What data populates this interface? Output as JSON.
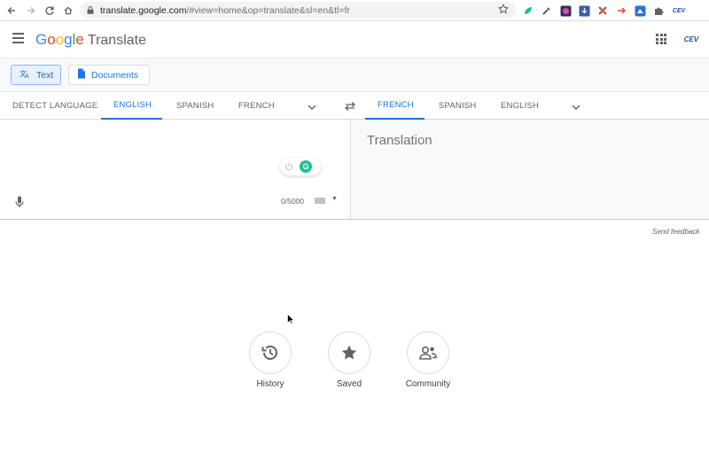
{
  "browser": {
    "url_host": "translate.google.com",
    "url_path": "/#view=home&op=translate&sl=en&tl=fr",
    "account_badge": "CEV"
  },
  "header": {
    "logo_letters": [
      "G",
      "o",
      "o",
      "g",
      "l",
      "e"
    ],
    "logo_colors": [
      "#4285f4",
      "#ea4335",
      "#fbbc05",
      "#4285f4",
      "#34a853",
      "#ea4335"
    ],
    "product": "Translate",
    "account": "CEV"
  },
  "modes": {
    "text_label": "Text",
    "documents_label": "Documents"
  },
  "source_langs": {
    "detect": "DETECT LANGUAGE",
    "lang1": "ENGLISH",
    "lang2": "SPANISH",
    "lang3": "FRENCH"
  },
  "target_langs": {
    "lang1": "FRENCH",
    "lang2": "SPANISH",
    "lang3": "ENGLISH"
  },
  "source": {
    "char_count": "0/5000"
  },
  "target": {
    "placeholder": "Translation"
  },
  "feedback": "Send feedback",
  "actions": {
    "history": "History",
    "saved": "Saved",
    "community": "Community"
  },
  "colors": {
    "accent": "#1a73e8",
    "grammarly": "#15c39a"
  }
}
